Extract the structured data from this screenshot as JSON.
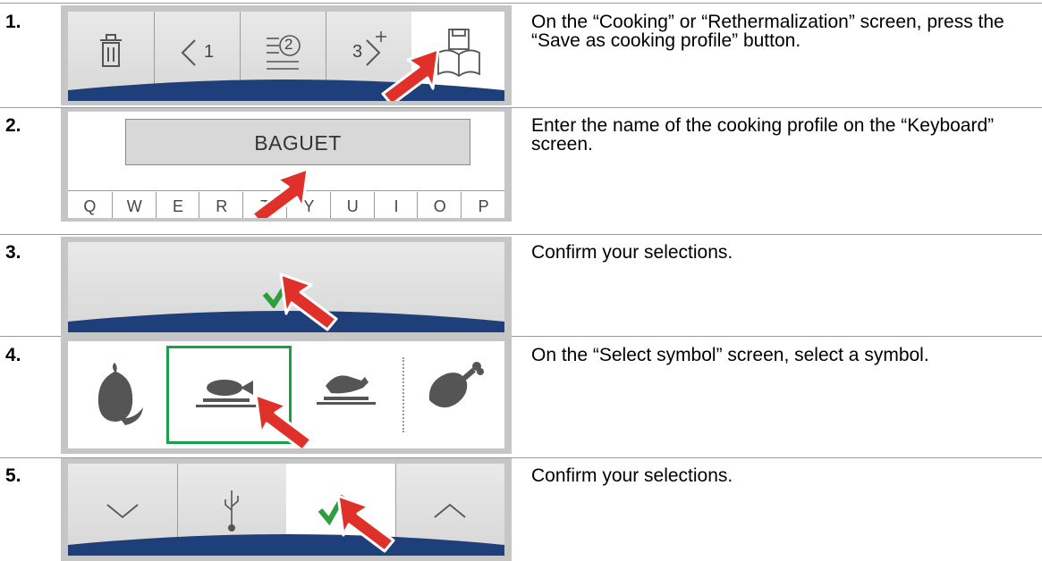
{
  "steps": [
    {
      "number": "1.",
      "instruction": "On the “Cooking” or “Rethermalization” screen, press the “Save as cooking profile” button."
    },
    {
      "number": "2.",
      "instruction": "Enter the name of the cooking profile on the “Keyboard” screen."
    },
    {
      "number": "3.",
      "instruction": "Confirm your selections."
    },
    {
      "number": "4.",
      "instruction": "On the “Select symbol” screen, select a symbol."
    },
    {
      "number": "5.",
      "instruction": "Confirm your selections."
    }
  ],
  "step1_panel": {
    "back_label": "1",
    "forward_label": "3",
    "step_badge": "2"
  },
  "step2_panel": {
    "input_value": "BAGUET",
    "keys": [
      "Q",
      "W",
      "E",
      "R",
      "T",
      "Y",
      "U",
      "I",
      "O",
      "P"
    ]
  },
  "colors": {
    "accent_navy": "#1e3f7a",
    "confirm_green": "#2e9e3e",
    "arrow_red": "#e0302a",
    "selection_green": "#1aa04a",
    "panel_gray": "#c6c6c6"
  }
}
